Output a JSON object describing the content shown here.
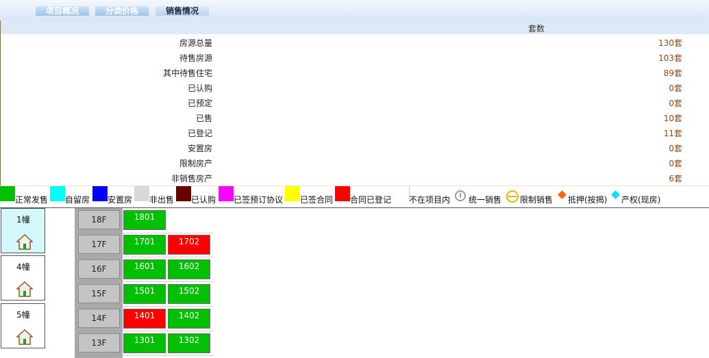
{
  "tabs": [
    {
      "label": "项目概况"
    },
    {
      "label": "分类价格"
    },
    {
      "label": "销售情况"
    }
  ],
  "summary": {
    "column_header": "套数",
    "rows": [
      {
        "label": "房源总量",
        "value": "130套"
      },
      {
        "label": "待售房源",
        "value": "103套"
      },
      {
        "label": "其中待售住宅",
        "value": "89套"
      },
      {
        "label": "已认购",
        "value": "0套"
      },
      {
        "label": "已预定",
        "value": "0套"
      },
      {
        "label": "已售",
        "value": "10套"
      },
      {
        "label": "已登记",
        "value": "11套"
      },
      {
        "label": "安置房",
        "value": "0套"
      },
      {
        "label": "限制房产",
        "value": "0套"
      },
      {
        "label": "非销售房产",
        "value": "6套"
      }
    ]
  },
  "legend": [
    {
      "label": "正常发售",
      "color": "#00c000"
    },
    {
      "label": "自留房",
      "color": "#00ffff"
    },
    {
      "label": "安置房",
      "color": "#0000ff"
    },
    {
      "label": "非出售",
      "color": "#d8d8d8"
    },
    {
      "label": "已认购",
      "color": "#660000"
    },
    {
      "label": "已签预订协议",
      "color": "#ff00ff"
    },
    {
      "label": "已签合同",
      "color": "#ffff00"
    },
    {
      "label": "合同已登记",
      "color": "#ff0000"
    },
    {
      "label": "不在项目内",
      "color": "#ffffff"
    },
    {
      "label": "统一销售",
      "icon": "info-circle-icon"
    },
    {
      "label": "限制销售",
      "icon": "limit-circle-icon"
    },
    {
      "label": "抵押(按揭)",
      "icon": "orange-diamond-icon",
      "color": "#ff6600"
    },
    {
      "label": "产权(现房)",
      "icon": "cyan-diamond-icon",
      "color": "#00e5ff"
    }
  ],
  "buildings": [
    {
      "name": "1幢",
      "active": true
    },
    {
      "name": "4幢",
      "active": false
    },
    {
      "name": "5幢",
      "active": false
    }
  ],
  "floors": [
    {
      "label": "18F",
      "units": [
        {
          "no": "1801",
          "color": "#00c000"
        }
      ]
    },
    {
      "label": "17F",
      "units": [
        {
          "no": "1701",
          "color": "#00c000"
        },
        {
          "no": "1702",
          "color": "#ff0000"
        }
      ]
    },
    {
      "label": "16F",
      "units": [
        {
          "no": "1601",
          "color": "#00c000"
        },
        {
          "no": "1602",
          "color": "#00c000"
        }
      ]
    },
    {
      "label": "15F",
      "units": [
        {
          "no": "1501",
          "color": "#00c000"
        },
        {
          "no": "1502",
          "color": "#00c000"
        }
      ]
    },
    {
      "label": "14F",
      "units": [
        {
          "no": "1401",
          "color": "#ff0000"
        },
        {
          "no": "1402",
          "color": "#00c000"
        }
      ]
    },
    {
      "label": "13F",
      "units": [
        {
          "no": "1301",
          "color": "#00c000"
        },
        {
          "no": "1302",
          "color": "#00c000"
        }
      ]
    }
  ]
}
